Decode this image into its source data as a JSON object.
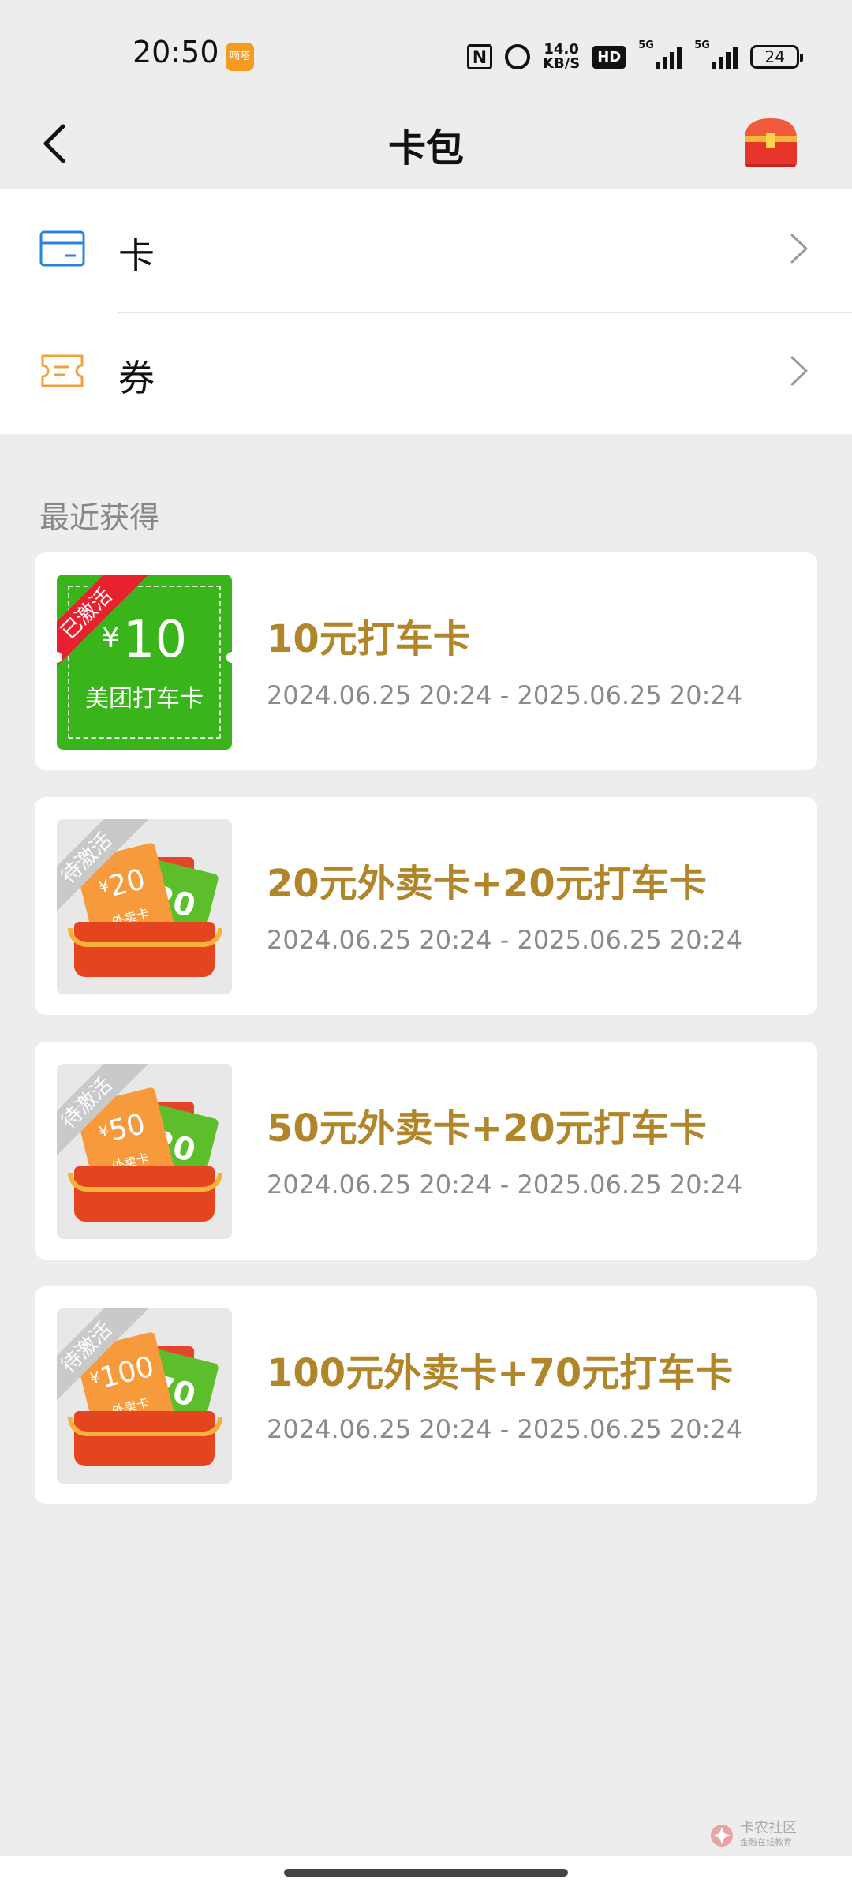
{
  "status_bar": {
    "time": "20:50",
    "app_badge": "嘀嗒",
    "nfc": "N",
    "speed_value": "14.0",
    "speed_unit": "KB/S",
    "hd": "HD",
    "signal1": "5G",
    "signal2": "5G",
    "battery": "24"
  },
  "header": {
    "title": "卡包",
    "back_icon": "back-arrow-icon",
    "right_icon": "treasure-chest-icon"
  },
  "menu": {
    "items": [
      {
        "label": "卡",
        "icon": "card-icon"
      },
      {
        "label": "券",
        "icon": "coupon-ticket-icon"
      }
    ]
  },
  "recent": {
    "title": "最近获得",
    "cards": [
      {
        "title": "10元打车卡",
        "date": "2024.06.25 20:24 - 2025.06.25 20:24",
        "status": "已激活",
        "thumb_currency": "¥",
        "thumb_amount": "10",
        "thumb_sub": "美团打车卡"
      },
      {
        "title": "20元外卖卡+20元打车卡",
        "date": "2024.06.25 20:24 - 2025.06.25 20:24",
        "status": "待激活",
        "thumb_currency": "¥",
        "thumb_amount": "20",
        "thumb_sub": "外卖卡",
        "thumb_green": "20"
      },
      {
        "title": "50元外卖卡+20元打车卡",
        "date": "2024.06.25 20:24 - 2025.06.25 20:24",
        "status": "待激活",
        "thumb_currency": "¥",
        "thumb_amount": "50",
        "thumb_sub": "外卖卡",
        "thumb_green": "20"
      },
      {
        "title": "100元外卖卡+70元打车卡",
        "date": "2024.06.25 20:24 - 2025.06.25 20:24",
        "status": "待激活",
        "thumb_currency": "¥",
        "thumb_amount": "100",
        "thumb_sub": "外卖卡",
        "thumb_green": "70"
      }
    ]
  },
  "watermark": {
    "title": "卡农社区",
    "subtitle": "金融在线教育"
  },
  "colors": {
    "accent_gold": "#b1862a",
    "green_card": "#39b51b",
    "active_ribbon": "#e8212f",
    "pending_ribbon": "#c9c9c9",
    "card_icon_blue": "#2b83e0",
    "coupon_icon_orange": "#f0a13b"
  }
}
